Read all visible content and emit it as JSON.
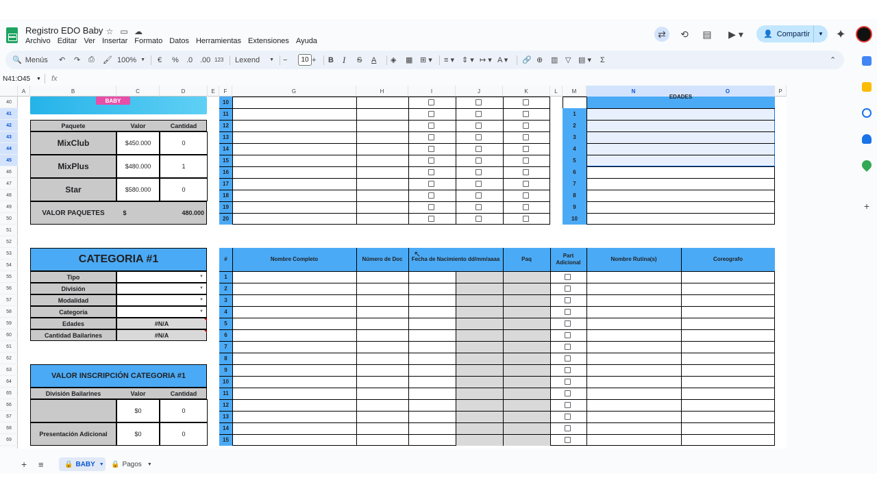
{
  "doc": {
    "title": "Registro EDO Baby"
  },
  "menu": [
    "Archivo",
    "Editar",
    "Ver",
    "Insertar",
    "Formato",
    "Datos",
    "Herramientas",
    "Extensiones",
    "Ayuda"
  ],
  "share_label": "Compartir",
  "toolbar": {
    "search": "Menús",
    "zoom": "100%",
    "currency": "€",
    "percent": "%",
    "dec_less": ".0",
    "dec_more": ".00",
    "numfmt": "123",
    "font": "Lexend",
    "font_size": "10"
  },
  "namebox": "N41:O45",
  "fx": "fx",
  "columns": [
    "A",
    "B",
    "C",
    "D",
    "E",
    "F",
    "G",
    "H",
    "I",
    "J",
    "K",
    "L",
    "M",
    "N",
    "O",
    "P"
  ],
  "rows": [
    "40",
    "41",
    "42",
    "43",
    "44",
    "45",
    "46",
    "47",
    "48",
    "49",
    "50",
    "51",
    "52",
    "53",
    "54",
    "55",
    "56",
    "57",
    "58",
    "59",
    "60",
    "61",
    "62",
    "63",
    "64",
    "65",
    "66",
    "67",
    "68",
    "69"
  ],
  "banner_text": "BABY",
  "paquetes": {
    "headers": [
      "Paquete",
      "Valor",
      "Cantidad"
    ],
    "rows": [
      {
        "name": "MixClub",
        "valor": "$450.000",
        "cantidad": "0"
      },
      {
        "name": "MixPlus",
        "valor": "$480.000",
        "cantidad": "1"
      },
      {
        "name": "Star",
        "valor": "$580.000",
        "cantidad": "0"
      }
    ],
    "total_label": "VALOR PAQUETES",
    "total_sym": "$",
    "total": "480.000"
  },
  "top_numbers": [
    "10",
    "11",
    "12",
    "13",
    "14",
    "15",
    "16",
    "17",
    "18",
    "19",
    "20"
  ],
  "m_numbers": [
    "1",
    "2",
    "3",
    "4",
    "5",
    "6",
    "7",
    "8",
    "9",
    "10"
  ],
  "m_header": "EDADES",
  "categoria": {
    "title": "CATEGORIA #1",
    "fields": [
      "Tipo",
      "División",
      "Modalidad",
      "Categoría",
      "Edades",
      "Cantidad Bailarines"
    ],
    "edades_val": "#N/A",
    "cantidad_val": "#N/A"
  },
  "inscripcion": {
    "title": "VALOR INSCRIPCIÓN CATEGORIA #1",
    "headers": [
      "División Bailarines",
      "Valor",
      "Cantidad"
    ],
    "rows": [
      {
        "label": "",
        "valor": "$0",
        "cantidad": "0"
      },
      {
        "label": "Presentación Adicional",
        "valor": "$0",
        "cantidad": "0"
      }
    ]
  },
  "table": {
    "headers": [
      "#",
      "Nombre Completo",
      "Número de Doc",
      "Fecha de Nacimiento dd/mm/aaaa",
      "Paq",
      "Part Adicional",
      "Nombre Rutina(s)",
      "Coreografo"
    ],
    "numbers": [
      "1",
      "2",
      "3",
      "4",
      "5",
      "6",
      "7",
      "8",
      "9",
      "10",
      "11",
      "12",
      "13",
      "14",
      "15"
    ]
  },
  "tabs": {
    "sheet1": "BABY",
    "sheet2": "Pagos"
  }
}
